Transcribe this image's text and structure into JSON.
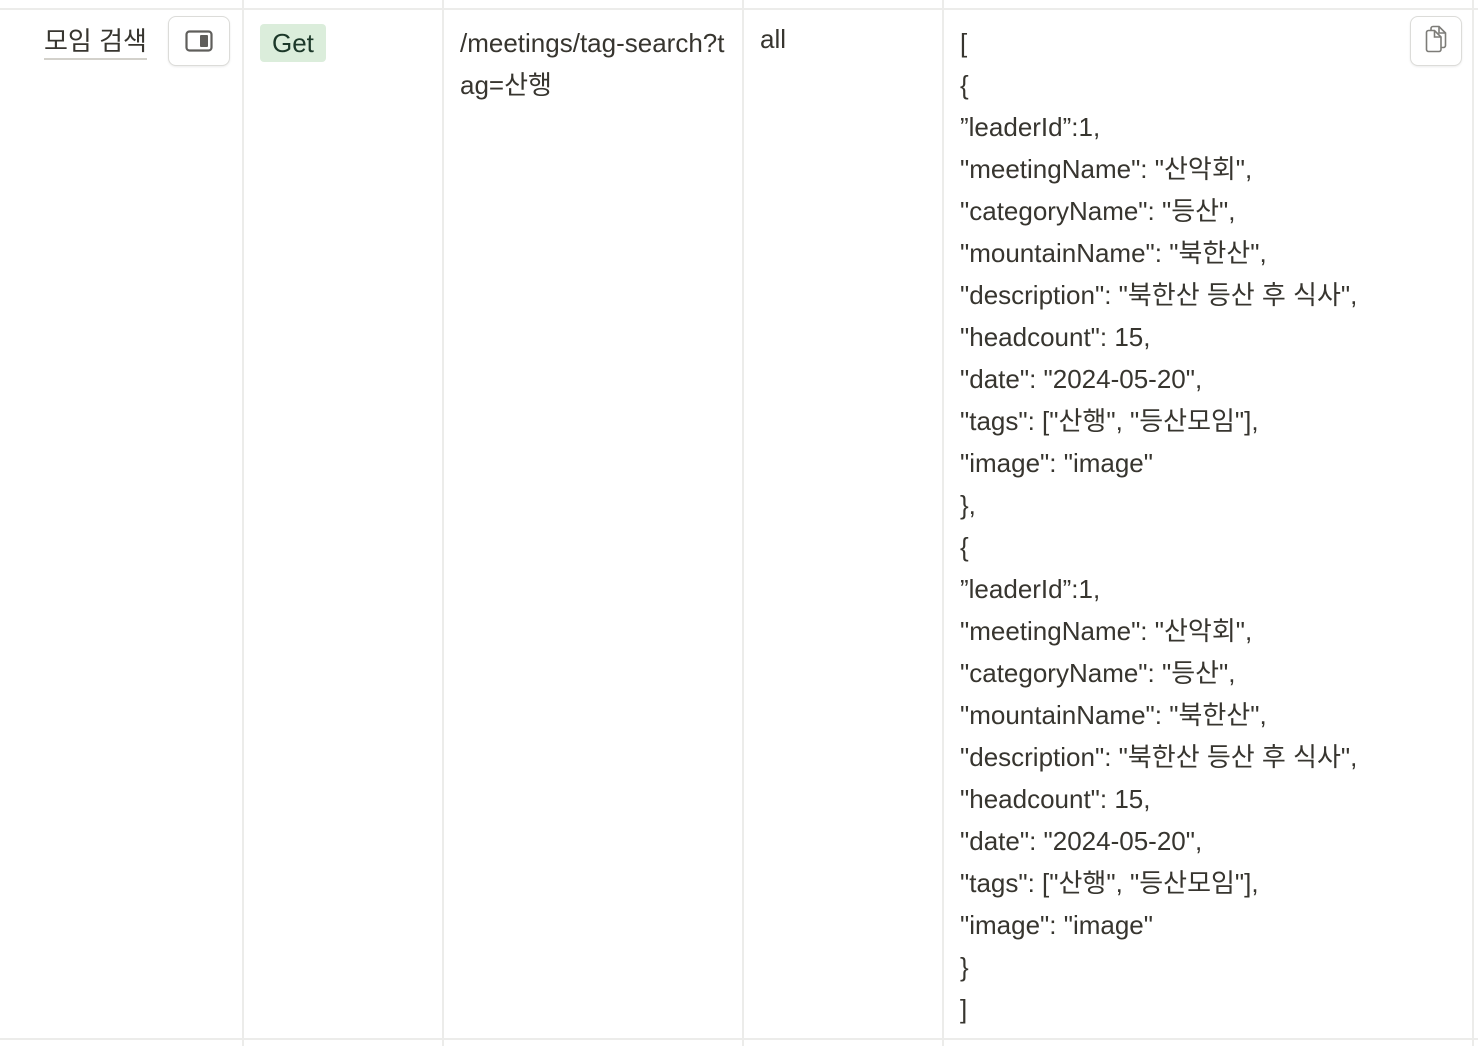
{
  "row": {
    "name": "모임 검색",
    "method": "Get",
    "url": "/meetings/tag-search?tag=산행",
    "auth": "all",
    "response_lines": [
      "[",
      "{",
      "”leaderId”:1,",
      "\"meetingName\": \"산악회\",",
      "\"categoryName\": \"등산\",",
      "\"mountainName\": \"북한산\",",
      "\"description\": \"북한산 등산 후 식사\",",
      "\"headcount\": 15,",
      "\"date\": \"2024-05-20\",",
      "\"tags\": [\"산행\", \"등산모임\"],",
      "\"image\": \"image\"",
      "},",
      "{",
      "”leaderId”:1,",
      "\"meetingName\": \"산악회\",",
      "\"categoryName\": \"등산\",",
      "\"mountainName\": \"북한산\",",
      "\"description\": \"북한산 등산 후 식사\",",
      "\"headcount\": 15,",
      "\"date\": \"2024-05-20\",",
      "\"tags\": [\"산행\", \"등산모임\"],",
      "\"image\": \"image\"",
      "}",
      "]"
    ]
  },
  "icons": {
    "open_in_side_peek": "side-peek-icon",
    "copy": "copy-icon"
  },
  "colors": {
    "method_tag_bg": "#dbeddb",
    "method_tag_text": "#1c3829",
    "grid_line": "#ececea",
    "text": "#37352f"
  }
}
